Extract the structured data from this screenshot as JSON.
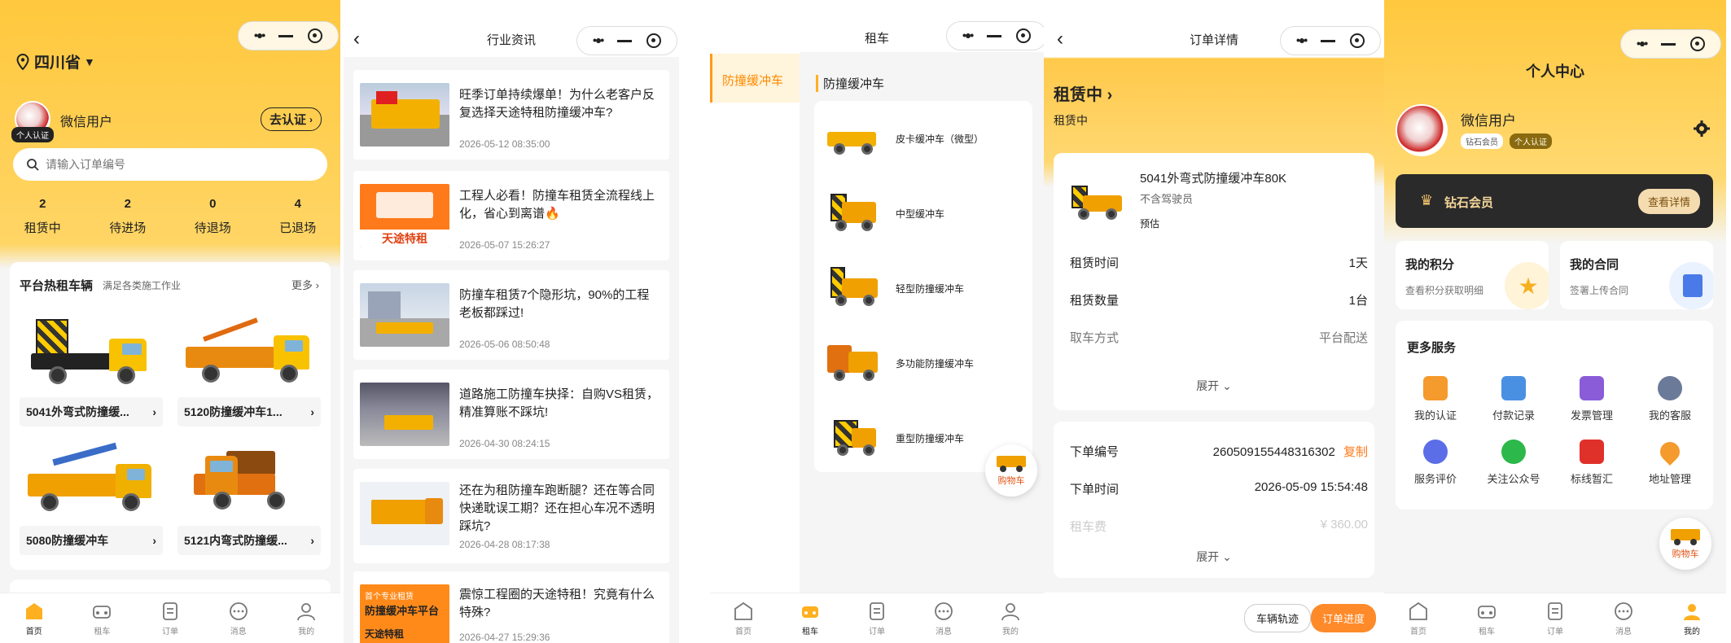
{
  "capsule": {
    "dots": "•●•"
  },
  "tabs": [
    {
      "label": "首页",
      "icon": "home-icon"
    },
    {
      "label": "租车",
      "icon": "car-icon"
    },
    {
      "label": "订单",
      "icon": "order-icon"
    },
    {
      "label": "消息",
      "icon": "message-icon"
    },
    {
      "label": "我的",
      "icon": "user-icon"
    }
  ],
  "home": {
    "location": "四川省",
    "username": "微信用户",
    "auth_badge": "个人认证",
    "certify_btn": "去认证",
    "search_placeholder": "请输入订单编号",
    "stats": [
      {
        "num": "2",
        "label": "租赁中"
      },
      {
        "num": "2",
        "label": "待进场"
      },
      {
        "num": "0",
        "label": "待退场"
      },
      {
        "num": "4",
        "label": "已退场"
      }
    ],
    "hot_title": "平台热租车辆",
    "hot_sub": "满足各类施工作业",
    "more": "更多",
    "vehicles": [
      "5041外弯式防撞缓...",
      "5120防撞缓冲车1...",
      "5080防撞缓冲车",
      "5121内弯式防撞缓..."
    ]
  },
  "news": {
    "title": "行业资讯",
    "items": [
      {
        "title": "旺季订单持续爆单！为什么老客户反复选择天途特租防撞缓冲车?",
        "date": "2026-05-12 08:35:00"
      },
      {
        "title": "工程人必看！防撞车租赁全流程线上化，省心到离谱🔥",
        "date": "2026-05-07 15:26:27",
        "img_text": "天途特租"
      },
      {
        "title": "防撞车租赁7个隐形坑，90%的工程老板都踩过!",
        "date": "2026-05-06 08:50:48"
      },
      {
        "title": "道路施工防撞车抉择：自购VS租赁，精准算账不踩坑!",
        "date": "2026-04-30 08:24:15"
      },
      {
        "title": "还在为租防撞车跑断腿？还在等合同快递耽误工期？还在担心车况不透明踩坑?",
        "date": "2026-04-28 08:17:38"
      },
      {
        "title": "震惊工程圈的天途特租！究竟有什么特殊?",
        "date": "2026-04-27 15:29:36",
        "img_line1": "首个专业租赁",
        "img_line2": "防撞缓冲车平台",
        "img_line3": "天途特租"
      }
    ]
  },
  "rent": {
    "title": "租车",
    "side_category": "防撞缓冲车",
    "section_title": "防撞缓冲车",
    "categories": [
      "皮卡缓冲车（微型）",
      "中型缓冲车",
      "轻型防撞缓冲车",
      "多功能防撞缓冲车",
      "重型防撞缓冲车"
    ],
    "cart": "购物车"
  },
  "order": {
    "title": "订单详情",
    "status": "租赁中",
    "status_sub": "租赁中",
    "product_name": "5041外弯式防撞缓冲车80K",
    "driver": "不含驾驶员",
    "estimate": "预估",
    "rows": [
      {
        "k": "租赁时间",
        "v": "1天"
      },
      {
        "k": "租赁数量",
        "v": "1台"
      },
      {
        "k": "取车方式",
        "v": "平台配送"
      }
    ],
    "expand": "展开",
    "order_no_label": "下单编号",
    "order_no": "260509155448316302",
    "copy": "复制",
    "order_time_label": "下单时间",
    "order_time": "2026-05-09 15:54:48",
    "fee_label": "租车费",
    "fee": "¥ 360.00",
    "btn_track": "车辆轨迹",
    "btn_progress": "订单进度"
  },
  "me": {
    "title": "个人中心",
    "username": "微信用户",
    "badge_vip": "钻石会员",
    "badge_auth": "个人认证",
    "vip_title": "钻石会员",
    "vip_btn": "查看详情",
    "points_title": "我的积分",
    "points_sub": "查看积分获取明细",
    "contract_title": "我的合同",
    "contract_sub": "签署上传合同",
    "more_services": "更多服务",
    "services": [
      {
        "label": "我的认证",
        "icon": "certify-icon",
        "color": "#f59a2c"
      },
      {
        "label": "付款记录",
        "icon": "payment-record-icon",
        "color": "#4a90e2"
      },
      {
        "label": "发票管理",
        "icon": "invoice-icon",
        "color": "#8a5cd8"
      },
      {
        "label": "我的客服",
        "icon": "customer-service-icon",
        "color": "#6b7a99"
      },
      {
        "label": "服务评价",
        "icon": "review-icon",
        "color": "#5b6ee8"
      },
      {
        "label": "关注公众号",
        "icon": "wechat-follow-icon",
        "color": "#2cb84a"
      },
      {
        "label": "标线暂汇",
        "icon": "marking-icon",
        "color": "#e0302a"
      },
      {
        "label": "地址管理",
        "icon": "address-icon",
        "color": "#f59a2c"
      }
    ],
    "cart": "购物车"
  },
  "colors": {
    "brand": "#ffc83d",
    "accent": "#ff7a1a",
    "text": "#222222"
  }
}
